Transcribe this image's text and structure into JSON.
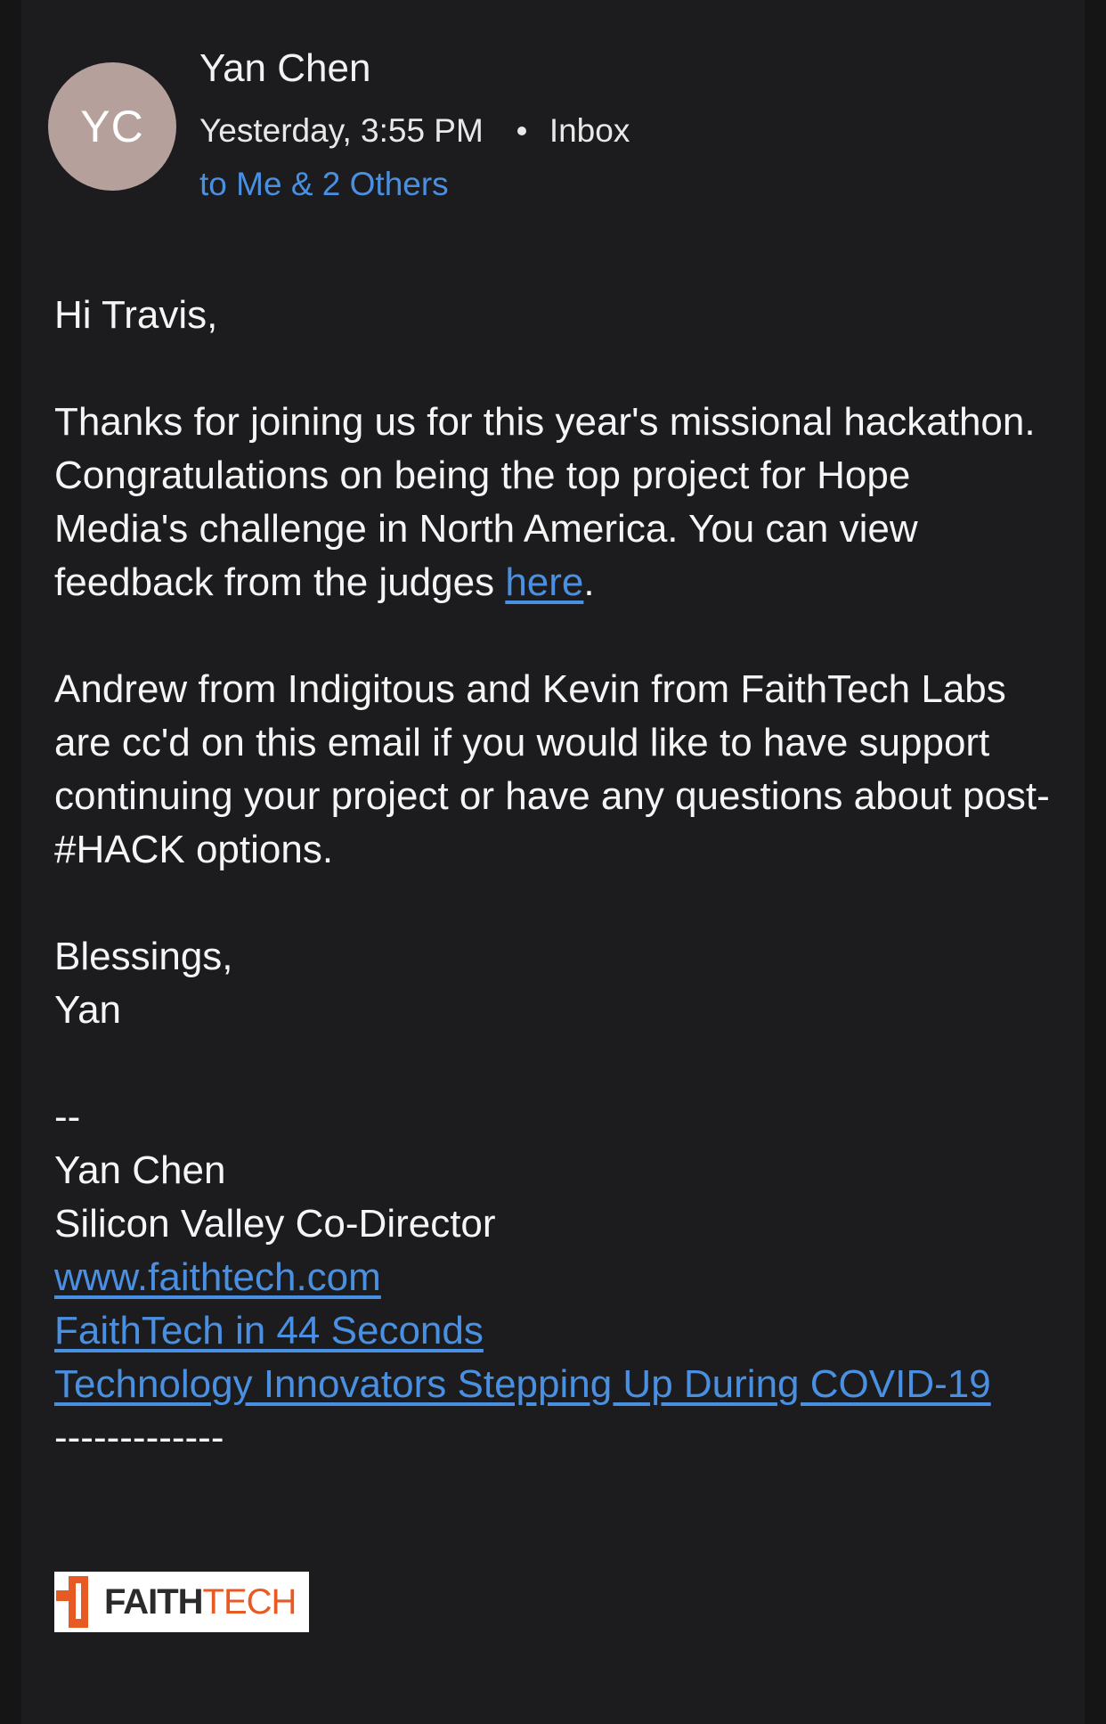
{
  "header": {
    "avatar_initials": "YC",
    "sender_name": "Yan Chen",
    "timestamp": "Yesterday, 3:55 PM",
    "folder": "Inbox",
    "recipients": "to Me & 2 Others"
  },
  "email": {
    "greeting": "Hi Travis,",
    "para1_text": "Thanks for joining us for this year's missional hackathon. Congratulations on being the top project for Hope Media's challenge in North America. You can view feedback from the judges ",
    "para1_link": "here",
    "para1_end": ".",
    "para2": "Andrew from Indigitous and Kevin from FaithTech Labs are cc'd on this email if you would like to have support continuing your project or have any questions about post-#HACK options.",
    "closing": "Blessings,",
    "closing_name": "Yan"
  },
  "signature": {
    "separator": "--",
    "name": "Yan Chen",
    "title": "Silicon Valley Co-Director",
    "links": [
      "www.faithtech.com",
      "FaithTech in 44 Seconds",
      "Technology Innovators Stepping Up During COVID-19"
    ],
    "divider": "-------------",
    "logo_text_part1": "FAITH",
    "logo_text_part2": "TECH"
  },
  "colors": {
    "background": "#1c1c1e",
    "text": "#f5f5f5",
    "link": "#4a90e2",
    "avatar": "#b5a09c",
    "brand_orange": "#e85a23"
  }
}
